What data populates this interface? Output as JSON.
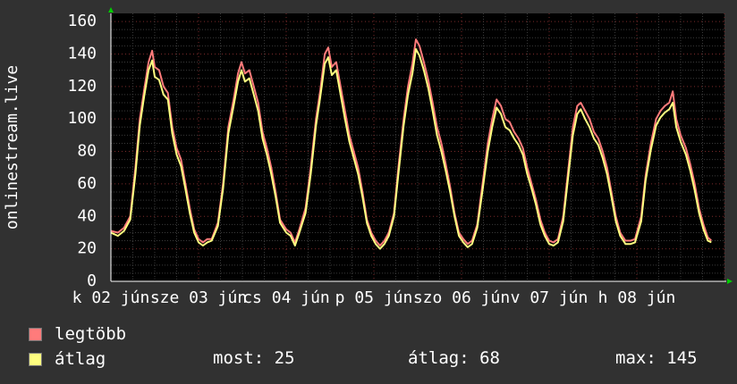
{
  "chart_data": {
    "type": "line",
    "ylabel": "onlinestream.live",
    "xlabel": "",
    "ylim": [
      0,
      165
    ],
    "y_ticks": [
      0,
      20,
      40,
      60,
      80,
      100,
      120,
      140,
      160
    ],
    "x_tick_labels": [
      "k 02 jún",
      "sze 03 jún",
      "cs 04 jún",
      "p 05 jún",
      "szo 06 jún",
      "v 07 jún",
      "h 08 jún"
    ],
    "grid": true,
    "x_days": [
      1,
      8
    ],
    "series": [
      {
        "name": "legtöbb",
        "color": "#ff7b7b",
        "points": [
          [
            1.0,
            31
          ],
          [
            1.08,
            30
          ],
          [
            1.15,
            33
          ],
          [
            1.22,
            40
          ],
          [
            1.28,
            70
          ],
          [
            1.33,
            100
          ],
          [
            1.38,
            118
          ],
          [
            1.43,
            135
          ],
          [
            1.47,
            142
          ],
          [
            1.5,
            132
          ],
          [
            1.55,
            130
          ],
          [
            1.6,
            120
          ],
          [
            1.65,
            116
          ],
          [
            1.7,
            95
          ],
          [
            1.75,
            82
          ],
          [
            1.8,
            75
          ],
          [
            1.85,
            60
          ],
          [
            1.9,
            45
          ],
          [
            1.95,
            32
          ],
          [
            2.0,
            26
          ],
          [
            2.05,
            24
          ],
          [
            2.1,
            26
          ],
          [
            2.15,
            26
          ],
          [
            2.22,
            36
          ],
          [
            2.28,
            60
          ],
          [
            2.34,
            95
          ],
          [
            2.4,
            112
          ],
          [
            2.45,
            128
          ],
          [
            2.49,
            135
          ],
          [
            2.53,
            128
          ],
          [
            2.58,
            130
          ],
          [
            2.63,
            120
          ],
          [
            2.68,
            110
          ],
          [
            2.73,
            92
          ],
          [
            2.78,
            82
          ],
          [
            2.83,
            70
          ],
          [
            2.88,
            55
          ],
          [
            2.93,
            38
          ],
          [
            3.0,
            32
          ],
          [
            3.05,
            30
          ],
          [
            3.1,
            24
          ],
          [
            3.15,
            32
          ],
          [
            3.22,
            45
          ],
          [
            3.28,
            70
          ],
          [
            3.34,
            100
          ],
          [
            3.39,
            118
          ],
          [
            3.44,
            140
          ],
          [
            3.48,
            144
          ],
          [
            3.52,
            132
          ],
          [
            3.57,
            135
          ],
          [
            3.62,
            120
          ],
          [
            3.67,
            105
          ],
          [
            3.72,
            90
          ],
          [
            3.77,
            80
          ],
          [
            3.82,
            70
          ],
          [
            3.87,
            55
          ],
          [
            3.92,
            38
          ],
          [
            3.97,
            30
          ],
          [
            4.02,
            25
          ],
          [
            4.07,
            22
          ],
          [
            4.12,
            25
          ],
          [
            4.17,
            30
          ],
          [
            4.23,
            42
          ],
          [
            4.28,
            70
          ],
          [
            4.34,
            100
          ],
          [
            4.39,
            120
          ],
          [
            4.44,
            134
          ],
          [
            4.48,
            149
          ],
          [
            4.52,
            145
          ],
          [
            4.57,
            135
          ],
          [
            4.62,
            124
          ],
          [
            4.67,
            110
          ],
          [
            4.72,
            95
          ],
          [
            4.77,
            85
          ],
          [
            4.82,
            72
          ],
          [
            4.87,
            58
          ],
          [
            4.92,
            42
          ],
          [
            4.97,
            30
          ],
          [
            5.02,
            26
          ],
          [
            5.07,
            23
          ],
          [
            5.12,
            25
          ],
          [
            5.18,
            35
          ],
          [
            5.24,
            60
          ],
          [
            5.3,
            85
          ],
          [
            5.35,
            100
          ],
          [
            5.4,
            112
          ],
          [
            5.45,
            108
          ],
          [
            5.5,
            100
          ],
          [
            5.55,
            98
          ],
          [
            5.6,
            92
          ],
          [
            5.65,
            88
          ],
          [
            5.7,
            82
          ],
          [
            5.75,
            70
          ],
          [
            5.8,
            60
          ],
          [
            5.85,
            50
          ],
          [
            5.9,
            38
          ],
          [
            5.95,
            30
          ],
          [
            6.0,
            25
          ],
          [
            6.05,
            24
          ],
          [
            6.1,
            26
          ],
          [
            6.16,
            40
          ],
          [
            6.22,
            70
          ],
          [
            6.27,
            95
          ],
          [
            6.32,
            108
          ],
          [
            6.36,
            110
          ],
          [
            6.41,
            105
          ],
          [
            6.46,
            100
          ],
          [
            6.51,
            92
          ],
          [
            6.56,
            88
          ],
          [
            6.61,
            80
          ],
          [
            6.66,
            70
          ],
          [
            6.71,
            55
          ],
          [
            6.76,
            40
          ],
          [
            6.81,
            30
          ],
          [
            6.87,
            25
          ],
          [
            6.93,
            25
          ],
          [
            6.98,
            26
          ],
          [
            7.05,
            40
          ],
          [
            7.1,
            65
          ],
          [
            7.16,
            85
          ],
          [
            7.22,
            100
          ],
          [
            7.27,
            105
          ],
          [
            7.32,
            108
          ],
          [
            7.37,
            110
          ],
          [
            7.41,
            117
          ],
          [
            7.45,
            100
          ],
          [
            7.5,
            90
          ],
          [
            7.56,
            82
          ],
          [
            7.61,
            72
          ],
          [
            7.66,
            60
          ],
          [
            7.71,
            45
          ],
          [
            7.76,
            35
          ],
          [
            7.81,
            27
          ],
          [
            7.85,
            25
          ]
        ]
      },
      {
        "name": "átlag",
        "color": "#ffff80",
        "points": [
          [
            1.0,
            30
          ],
          [
            1.08,
            28
          ],
          [
            1.15,
            31
          ],
          [
            1.22,
            38
          ],
          [
            1.28,
            66
          ],
          [
            1.33,
            96
          ],
          [
            1.38,
            114
          ],
          [
            1.43,
            130
          ],
          [
            1.47,
            136
          ],
          [
            1.5,
            126
          ],
          [
            1.55,
            124
          ],
          [
            1.6,
            115
          ],
          [
            1.65,
            112
          ],
          [
            1.7,
            91
          ],
          [
            1.75,
            78
          ],
          [
            1.8,
            71
          ],
          [
            1.85,
            57
          ],
          [
            1.9,
            42
          ],
          [
            1.95,
            30
          ],
          [
            2.0,
            24
          ],
          [
            2.05,
            22
          ],
          [
            2.1,
            24
          ],
          [
            2.15,
            25
          ],
          [
            2.22,
            34
          ],
          [
            2.28,
            57
          ],
          [
            2.34,
            91
          ],
          [
            2.4,
            108
          ],
          [
            2.45,
            123
          ],
          [
            2.49,
            130
          ],
          [
            2.53,
            123
          ],
          [
            2.58,
            125
          ],
          [
            2.63,
            115
          ],
          [
            2.68,
            105
          ],
          [
            2.73,
            88
          ],
          [
            2.78,
            78
          ],
          [
            2.83,
            66
          ],
          [
            2.88,
            52
          ],
          [
            2.93,
            36
          ],
          [
            3.0,
            30
          ],
          [
            3.05,
            28
          ],
          [
            3.1,
            22
          ],
          [
            3.15,
            30
          ],
          [
            3.22,
            42
          ],
          [
            3.28,
            66
          ],
          [
            3.34,
            96
          ],
          [
            3.39,
            114
          ],
          [
            3.44,
            134
          ],
          [
            3.48,
            138
          ],
          [
            3.52,
            127
          ],
          [
            3.57,
            130
          ],
          [
            3.62,
            115
          ],
          [
            3.67,
            100
          ],
          [
            3.72,
            86
          ],
          [
            3.77,
            76
          ],
          [
            3.82,
            66
          ],
          [
            3.87,
            52
          ],
          [
            3.92,
            36
          ],
          [
            3.97,
            28
          ],
          [
            4.02,
            23
          ],
          [
            4.07,
            20
          ],
          [
            4.12,
            23
          ],
          [
            4.17,
            28
          ],
          [
            4.23,
            40
          ],
          [
            4.28,
            66
          ],
          [
            4.34,
            96
          ],
          [
            4.39,
            115
          ],
          [
            4.44,
            128
          ],
          [
            4.48,
            143
          ],
          [
            4.52,
            139
          ],
          [
            4.57,
            130
          ],
          [
            4.62,
            119
          ],
          [
            4.67,
            105
          ],
          [
            4.72,
            90
          ],
          [
            4.77,
            80
          ],
          [
            4.82,
            68
          ],
          [
            4.87,
            55
          ],
          [
            4.92,
            40
          ],
          [
            4.97,
            28
          ],
          [
            5.02,
            24
          ],
          [
            5.07,
            21
          ],
          [
            5.12,
            23
          ],
          [
            5.18,
            33
          ],
          [
            5.24,
            56
          ],
          [
            5.3,
            80
          ],
          [
            5.35,
            95
          ],
          [
            5.4,
            107
          ],
          [
            5.45,
            103
          ],
          [
            5.5,
            95
          ],
          [
            5.55,
            93
          ],
          [
            5.6,
            88
          ],
          [
            5.65,
            84
          ],
          [
            5.7,
            78
          ],
          [
            5.75,
            66
          ],
          [
            5.8,
            57
          ],
          [
            5.85,
            47
          ],
          [
            5.9,
            35
          ],
          [
            5.95,
            28
          ],
          [
            6.0,
            23
          ],
          [
            6.05,
            22
          ],
          [
            6.1,
            24
          ],
          [
            6.16,
            37
          ],
          [
            6.22,
            66
          ],
          [
            6.27,
            90
          ],
          [
            6.32,
            103
          ],
          [
            6.36,
            106
          ],
          [
            6.41,
            100
          ],
          [
            6.46,
            95
          ],
          [
            6.51,
            88
          ],
          [
            6.56,
            84
          ],
          [
            6.61,
            76
          ],
          [
            6.66,
            66
          ],
          [
            6.71,
            52
          ],
          [
            6.76,
            37
          ],
          [
            6.81,
            28
          ],
          [
            6.87,
            23
          ],
          [
            6.93,
            23
          ],
          [
            6.98,
            24
          ],
          [
            7.05,
            37
          ],
          [
            7.1,
            62
          ],
          [
            7.16,
            81
          ],
          [
            7.22,
            96
          ],
          [
            7.27,
            101
          ],
          [
            7.32,
            104
          ],
          [
            7.37,
            106
          ],
          [
            7.41,
            110
          ],
          [
            7.45,
            95
          ],
          [
            7.5,
            86
          ],
          [
            7.56,
            78
          ],
          [
            7.61,
            68
          ],
          [
            7.66,
            56
          ],
          [
            7.71,
            42
          ],
          [
            7.76,
            32
          ],
          [
            7.81,
            25
          ],
          [
            7.85,
            24
          ]
        ]
      }
    ]
  },
  "legend": {
    "max_label": "legtöbb",
    "avg_label": "átlag",
    "max_color": "#ff7b7b",
    "avg_color": "#ffff80"
  },
  "stats": {
    "most": "most: 25",
    "atlag": "átlag: 68",
    "max": "max: 145"
  }
}
